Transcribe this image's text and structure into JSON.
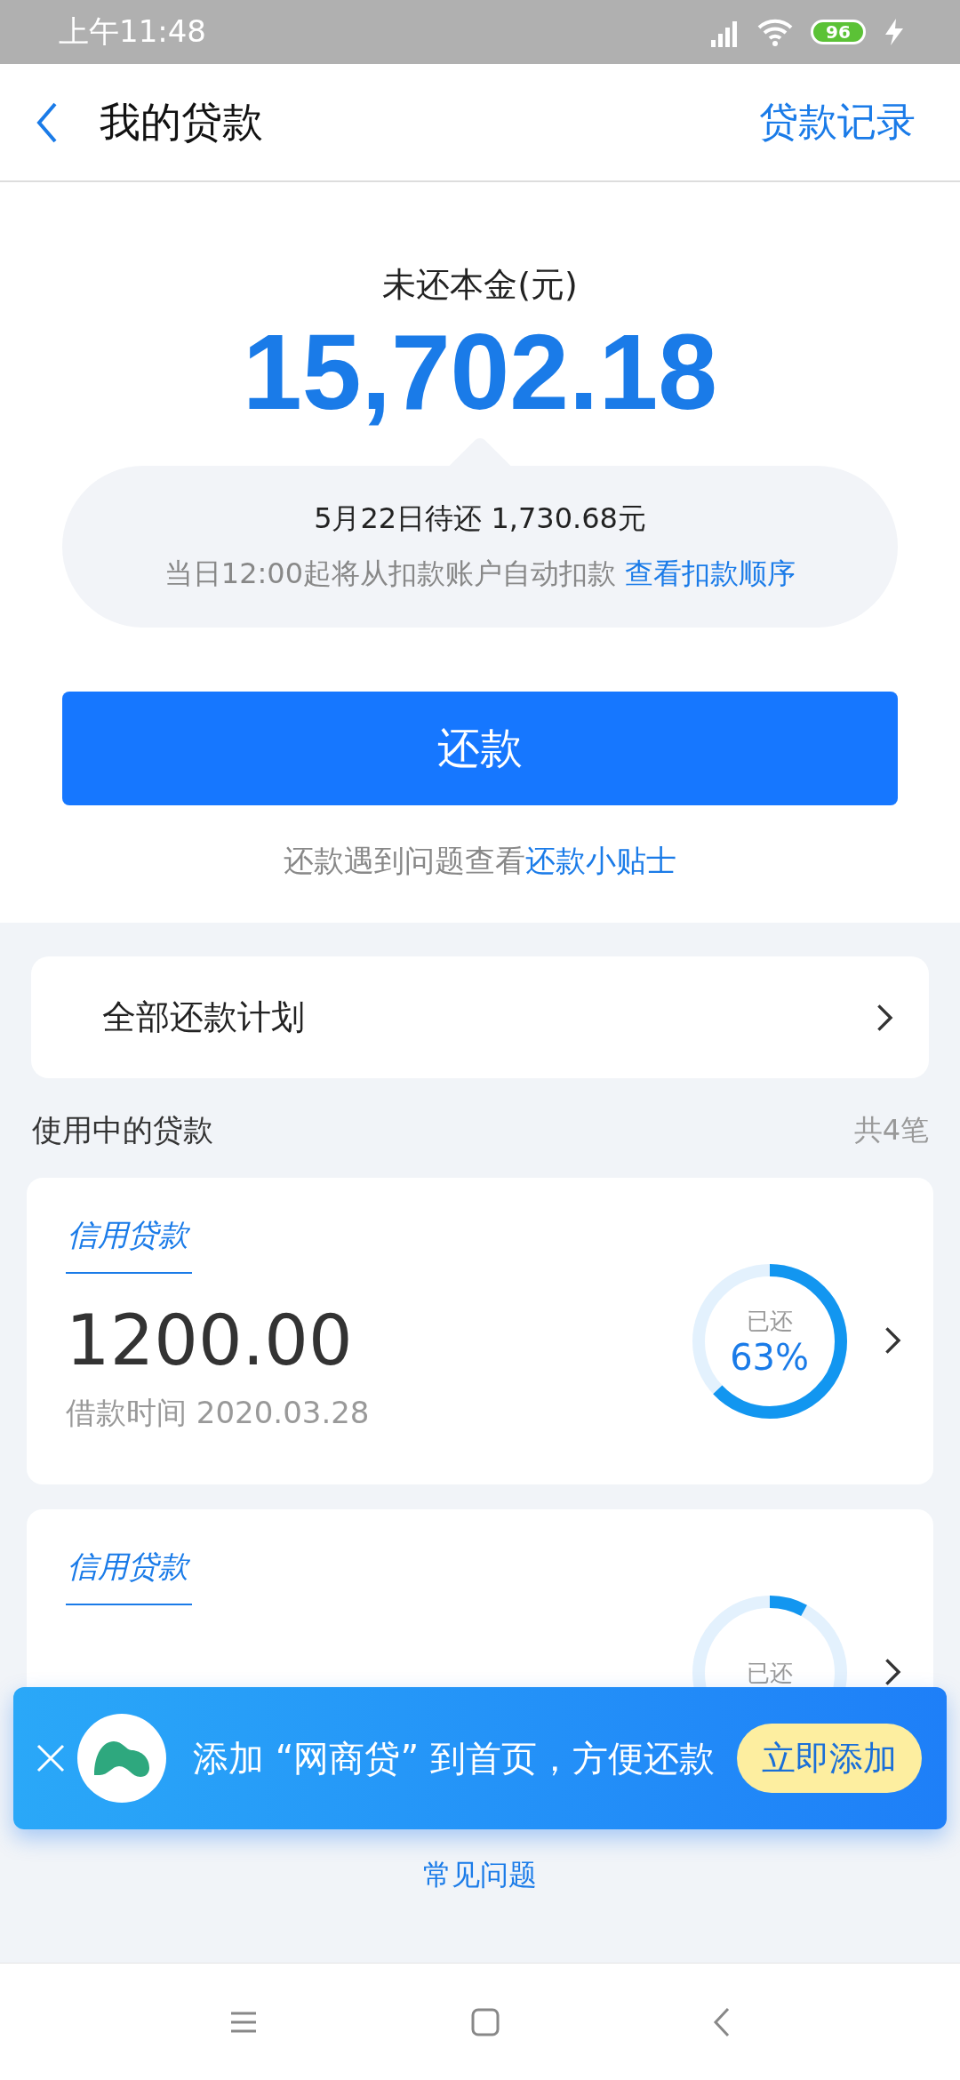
{
  "status_bar": {
    "time": "上午11:48",
    "battery": "96"
  },
  "header": {
    "title": "我的贷款",
    "action": "贷款记录"
  },
  "summary": {
    "label": "未还本金(元)",
    "amount": "15,702.18",
    "due": "5月22日待还 1,730.68元",
    "note": "当日12:00起将从扣款账户自动扣款",
    "note_link": "查看扣款顺序"
  },
  "repay_button": "还款",
  "tip": {
    "text": "还款遇到问题查看",
    "link": "还款小贴士"
  },
  "plan_row": {
    "label": "全部还款计划"
  },
  "loans_section": {
    "title": "使用中的贷款",
    "count": "共4笔"
  },
  "loans": [
    {
      "type": "信用贷款",
      "amount": "1200.00",
      "date": "借款时间 2020.03.28",
      "ring_label": "已还",
      "percent": "63%",
      "level": 0.63
    },
    {
      "type": "信用贷款",
      "ring_label": "已还",
      "level": 0.08
    }
  ],
  "banner": {
    "text": "添加 “网商贷” 到首页，方便还款",
    "button": "立即添加"
  },
  "faq": "常见问题"
}
